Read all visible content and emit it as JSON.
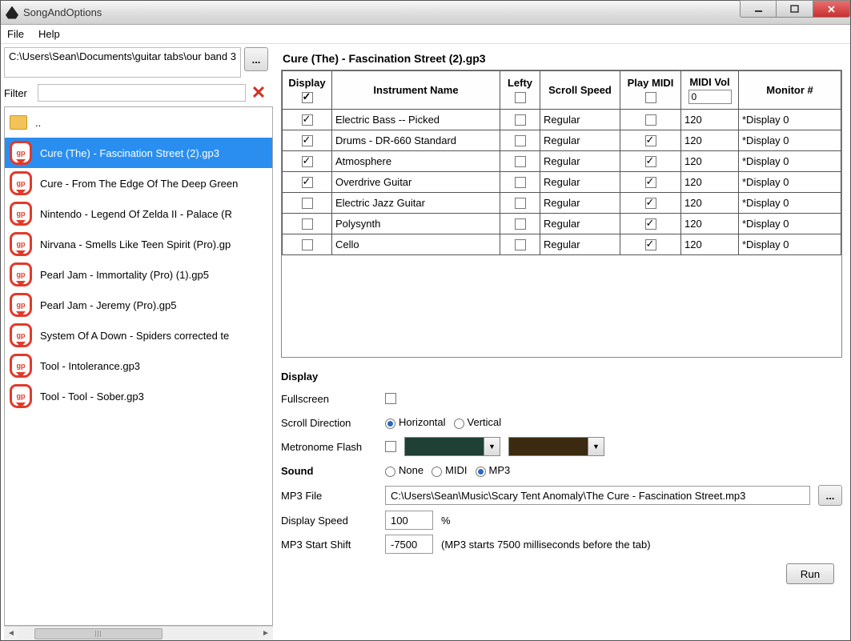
{
  "window": {
    "title": "SongAndOptions"
  },
  "menu": {
    "file": "File",
    "help": "Help"
  },
  "sidebar": {
    "path": "C:\\Users\\Sean\\Documents\\guitar tabs\\our band 3",
    "browse_btn": "...",
    "filter_label": "Filter",
    "filter_value": "",
    "up_label": "..",
    "files": [
      "Cure (The) - Fascination Street (2).gp3",
      "Cure - From The Edge Of The Deep Green",
      "Nintendo - Legend Of Zelda II - Palace (R",
      "Nirvana - Smells Like Teen Spirit (Pro).gp",
      "Pearl Jam - Immortality (Pro) (1).gp5",
      "Pearl Jam - Jeremy (Pro).gp5",
      "System Of A Down - Spiders corrected te",
      "Tool - Intolerance.gp3",
      "Tool - Tool - Sober.gp3"
    ],
    "selected_index": 0,
    "gp_badge": "gp"
  },
  "song": {
    "title": "Cure (The) - Fascination Street (2).gp3"
  },
  "grid": {
    "headers": {
      "display": "Display",
      "instrument": "Instrument Name",
      "lefty": "Lefty",
      "scroll": "Scroll Speed",
      "midi": "Play MIDI",
      "vol": "MIDI Vol",
      "monitor": "Monitor #"
    },
    "header_display_checked": true,
    "header_lefty_checked": false,
    "header_midi_checked": false,
    "header_vol_value": "0",
    "rows": [
      {
        "display": true,
        "name": "Electric Bass -- Picked",
        "lefty": false,
        "scroll": "Regular",
        "midi": false,
        "vol": "120",
        "mon": "*Display 0"
      },
      {
        "display": true,
        "name": "Drums - DR-660 Standard",
        "lefty": false,
        "scroll": "Regular",
        "midi": true,
        "vol": "120",
        "mon": "*Display 0"
      },
      {
        "display": true,
        "name": "Atmosphere",
        "lefty": false,
        "scroll": "Regular",
        "midi": true,
        "vol": "120",
        "mon": "*Display 0"
      },
      {
        "display": true,
        "name": "Overdrive Guitar",
        "lefty": false,
        "scroll": "Regular",
        "midi": true,
        "vol": "120",
        "mon": "*Display 0"
      },
      {
        "display": false,
        "name": "Electric Jazz Guitar",
        "lefty": false,
        "scroll": "Regular",
        "midi": true,
        "vol": "120",
        "mon": "*Display 0"
      },
      {
        "display": false,
        "name": "Polysynth",
        "lefty": false,
        "scroll": "Regular",
        "midi": true,
        "vol": "120",
        "mon": "*Display 0"
      },
      {
        "display": false,
        "name": "Cello",
        "lefty": false,
        "scroll": "Regular",
        "midi": true,
        "vol": "120",
        "mon": "*Display 0"
      }
    ]
  },
  "display": {
    "heading": "Display",
    "fullscreen_label": "Fullscreen",
    "fullscreen": false,
    "scroll_dir_label": "Scroll Direction",
    "horiz_label": "Horizontal",
    "vert_label": "Vertical",
    "scroll_dir": "horizontal",
    "metronome_label": "Metronome Flash",
    "metronome_enabled": false,
    "color1": "#1e4035",
    "color2": "#3b2a0f"
  },
  "sound": {
    "heading": "Sound",
    "none_label": "None",
    "midi_label": "MIDI",
    "mp3_label": "MP3",
    "selected": "mp3",
    "mp3file_label": "MP3 File",
    "mp3file": "C:\\Users\\Sean\\Music\\Scary Tent Anomaly\\The Cure - Fascination Street.mp3",
    "browse_btn": "...",
    "speed_label": "Display Speed",
    "speed_value": "100",
    "speed_unit": "%",
    "shift_label": "MP3 Start Shift",
    "shift_value": "-7500",
    "shift_note": "(MP3 starts 7500 milliseconds before the tab)"
  },
  "run_label": "Run"
}
